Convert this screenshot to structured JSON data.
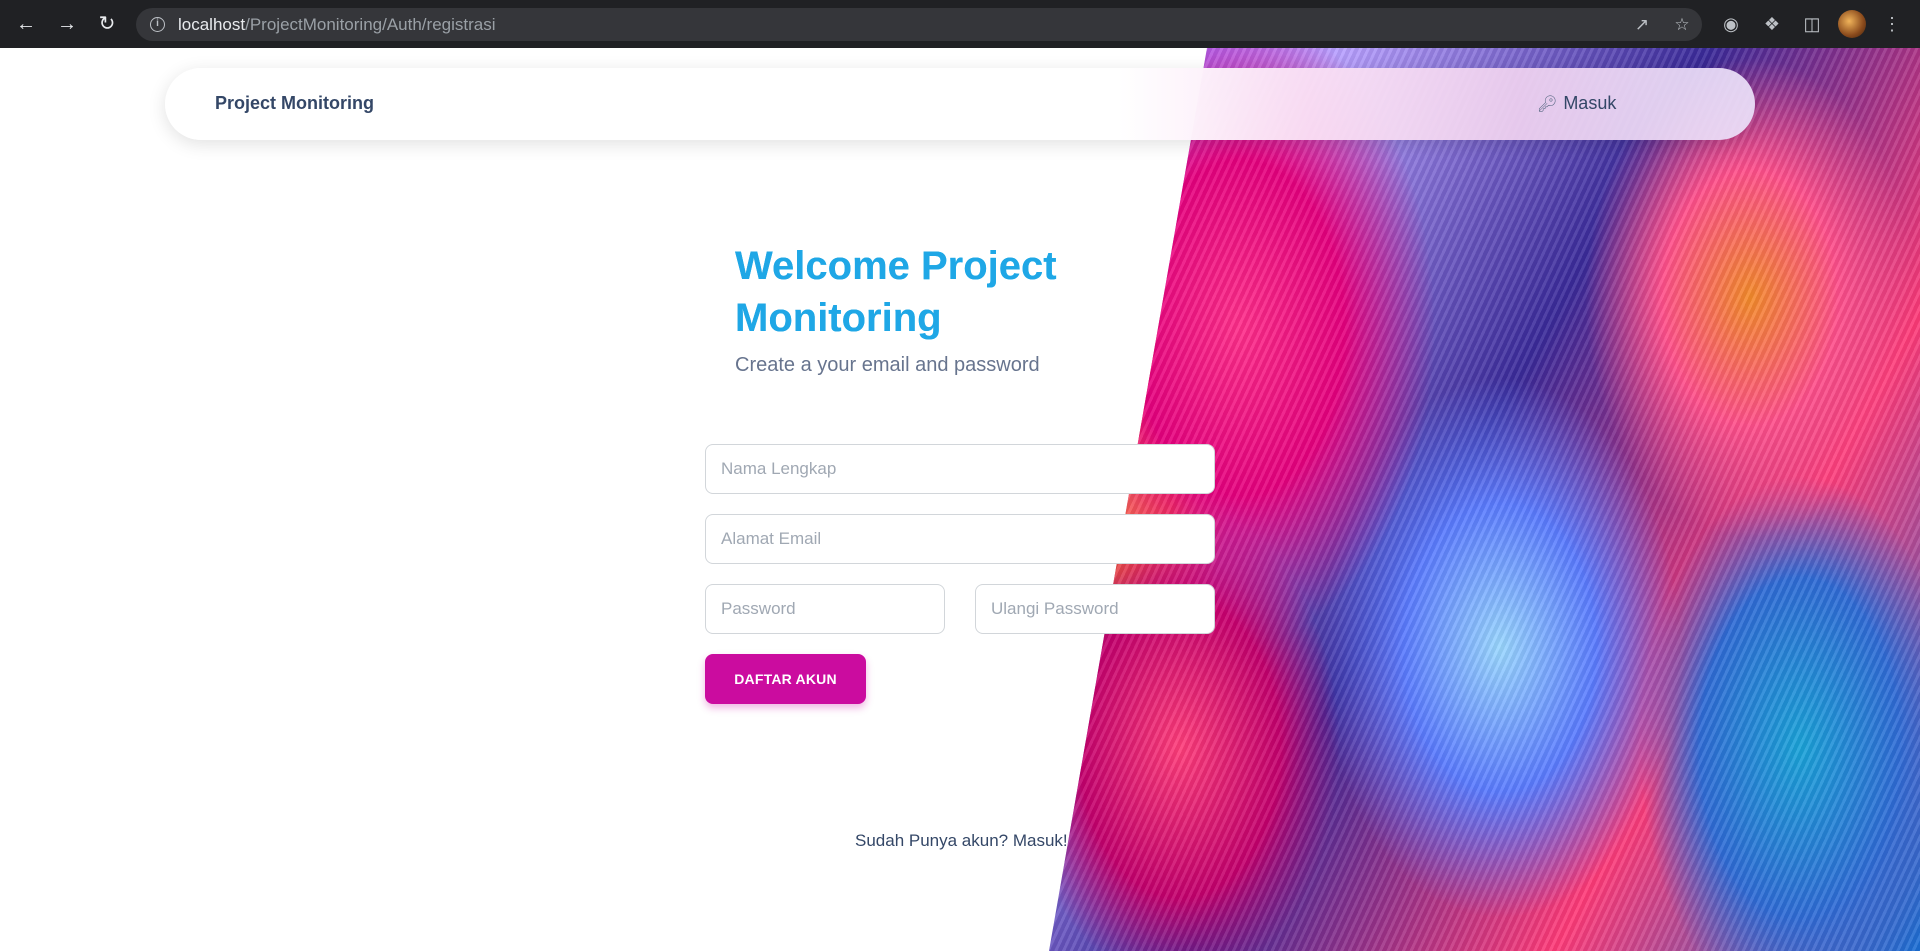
{
  "browser": {
    "url_host": "localhost",
    "url_path": "/ProjectMonitoring/Auth/registrasi",
    "icons": {
      "back": "back-arrow-icon",
      "forward": "forward-arrow-icon",
      "reload": "reload-icon",
      "info": "info-icon",
      "share": "share-icon",
      "bookmark": "star-icon",
      "screenshot": "camera-icon",
      "extensions": "puzzle-icon",
      "sidepanel": "side-panel-icon",
      "menu": "kebab-menu-icon"
    }
  },
  "navbar": {
    "brand": "Project Monitoring",
    "login_label": "Masuk",
    "login_icon": "key-icon"
  },
  "hero": {
    "title": "Welcome Project Monitoring",
    "subtitle": "Create a your email and password"
  },
  "form": {
    "name_placeholder": "Nama Lengkap",
    "email_placeholder": "Alamat Email",
    "password_placeholder": "Password",
    "password_confirm_placeholder": "Ulangi Password",
    "submit_label": "DAFTAR AKUN"
  },
  "footer": {
    "login_prompt": "Sudah Punya akun? Masuk!"
  },
  "colors": {
    "accent": "#cb0c9f",
    "title_gradient_start": "#1d9bd8",
    "title_gradient_end": "#21d4fd",
    "text_dark": "#344767",
    "text_muted": "#67748e"
  }
}
